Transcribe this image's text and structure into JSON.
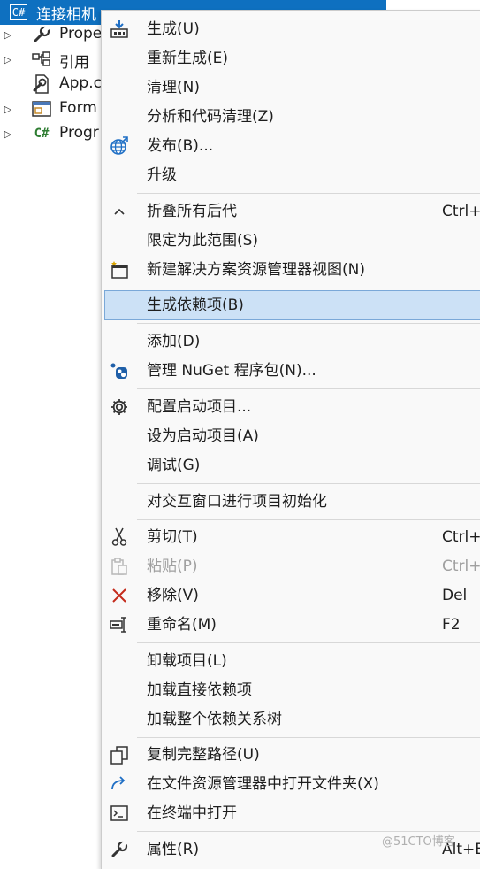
{
  "tree": {
    "root_badge": "C#",
    "root_label": "连接相机",
    "items": [
      {
        "label": "Prope",
        "icon": "wrench-icon",
        "expandable": true
      },
      {
        "label": "引用",
        "icon": "references-icon",
        "expandable": true
      },
      {
        "label": "App.c",
        "icon": "config-file-icon",
        "expandable": false
      },
      {
        "label": "Form",
        "icon": "form-icon",
        "expandable": true
      },
      {
        "label": "Progr",
        "icon": "csharp-file-icon",
        "expandable": true
      }
    ],
    "cs_glyph": "C#"
  },
  "menu": {
    "items": [
      {
        "label": "生成(U)",
        "icon": "build-icon"
      },
      {
        "label": "重新生成(E)"
      },
      {
        "label": "清理(N)"
      },
      {
        "label": "分析和代码清理(Z)"
      },
      {
        "label": "发布(B)...",
        "icon": "publish-globe-icon"
      },
      {
        "label": "升级"
      },
      {
        "label": "折叠所有后代",
        "shortcut": "Ctrl+",
        "icon": "collapse-chevron-icon"
      },
      {
        "label": "限定为此范围(S)"
      },
      {
        "label": "新建解决方案资源管理器视图(N)",
        "icon": "new-view-icon"
      },
      {
        "label": "生成依赖项(B)",
        "highlighted": true
      },
      {
        "label": "添加(D)"
      },
      {
        "label": "管理 NuGet 程序包(N)...",
        "icon": "nuget-icon"
      },
      {
        "label": "配置启动项目...",
        "icon": "gear-icon"
      },
      {
        "label": "设为启动项目(A)"
      },
      {
        "label": "调试(G)"
      },
      {
        "label": "对交互窗口进行项目初始化"
      },
      {
        "label": "剪切(T)",
        "shortcut": "Ctrl+",
        "icon": "scissors-icon"
      },
      {
        "label": "粘贴(P)",
        "shortcut": "Ctrl+",
        "icon": "paste-icon",
        "disabled": true
      },
      {
        "label": "移除(V)",
        "shortcut": "Del",
        "icon": "remove-x-icon"
      },
      {
        "label": "重命名(M)",
        "shortcut": "F2",
        "icon": "rename-icon"
      },
      {
        "label": "卸载项目(L)"
      },
      {
        "label": "加载直接依赖项"
      },
      {
        "label": "加载整个依赖关系树"
      },
      {
        "label": "复制完整路径(U)",
        "icon": "copy-icon"
      },
      {
        "label": "在文件资源管理器中打开文件夹(X)",
        "icon": "open-folder-arrow-icon"
      },
      {
        "label": "在终端中打开",
        "icon": "terminal-icon"
      },
      {
        "label": "属性(R)",
        "shortcut": "Alt+E",
        "icon": "wrench-icon"
      }
    ]
  },
  "watermark": "@51CTO博客",
  "colors": {
    "selection": "#0e70c0",
    "highlight": "#cce1f6",
    "menu_bg": "#f9f9f9",
    "remove_red": "#c42b1c",
    "accent_blue": "#1f6fc5"
  }
}
